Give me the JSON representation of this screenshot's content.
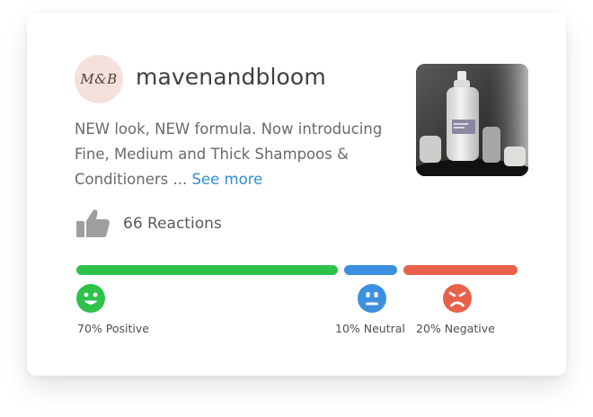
{
  "post": {
    "avatar_text": "M&B",
    "username": "mavenandbloom",
    "text": "NEW look, NEW formula. Now introducing Fine, Medium and Thick Shampoos & Conditioners ...",
    "see_more": "See more",
    "thumbnail_icon": "product-photo"
  },
  "reactions": {
    "label": "66 Reactions",
    "icon": "thumbs-up-icon"
  },
  "sentiment": {
    "positive": {
      "label": "70% Positive",
      "value": 70,
      "color": "#2ec24b"
    },
    "neutral": {
      "label": "10% Neutral",
      "value": 10,
      "color": "#3d8fe0"
    },
    "negative": {
      "label": "20% Negative",
      "value": 20,
      "color": "#e8614a"
    }
  }
}
